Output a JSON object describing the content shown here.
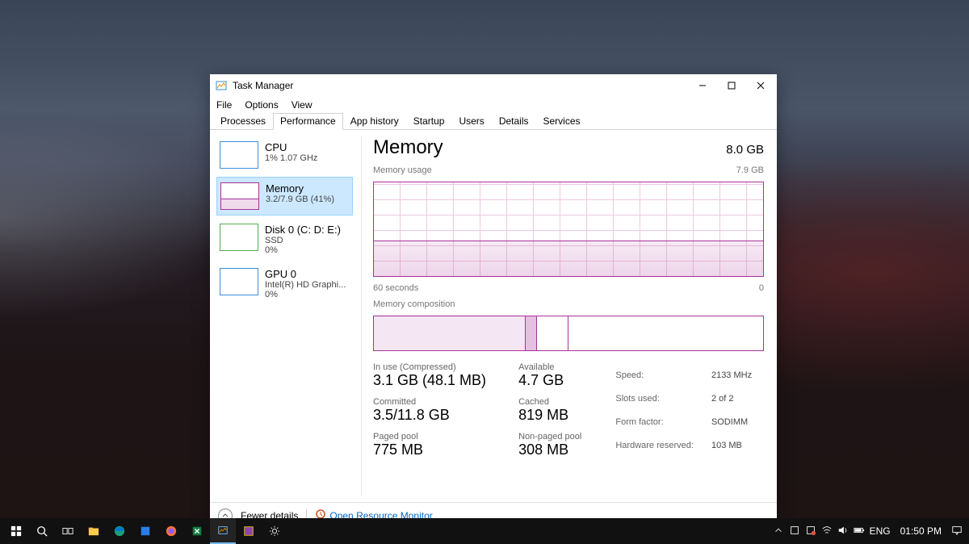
{
  "window": {
    "title": "Task Manager",
    "menus": {
      "file": "File",
      "options": "Options",
      "view": "View"
    },
    "tabs": {
      "processes": "Processes",
      "performance": "Performance",
      "apphistory": "App history",
      "startup": "Startup",
      "users": "Users",
      "details": "Details",
      "services": "Services"
    }
  },
  "sidebar": {
    "cpu": {
      "title": "CPU",
      "sub": "1% 1.07 GHz"
    },
    "memory": {
      "title": "Memory",
      "sub": "3.2/7.9 GB (41%)"
    },
    "disk": {
      "title": "Disk 0 (C: D: E:)",
      "sub1": "SSD",
      "sub2": "0%"
    },
    "gpu": {
      "title": "GPU 0",
      "sub1": "Intel(R) HD Graphi...",
      "sub2": "0%"
    }
  },
  "main": {
    "title": "Memory",
    "capacity": "8.0 GB",
    "usage_label": "Memory usage",
    "usage_max": "7.9 GB",
    "axis_left": "60 seconds",
    "axis_right": "0",
    "composition_label": "Memory composition",
    "stats": {
      "in_use_label": "In use (Compressed)",
      "in_use": "3.1 GB (48.1 MB)",
      "available_label": "Available",
      "available": "4.7 GB",
      "committed_label": "Committed",
      "committed": "3.5/11.8 GB",
      "cached_label": "Cached",
      "cached": "819 MB",
      "paged_label": "Paged pool",
      "paged": "775 MB",
      "nonpaged_label": "Non-paged pool",
      "nonpaged": "308 MB"
    },
    "info": {
      "speed_label": "Speed:",
      "speed": "2133 MHz",
      "slots_label": "Slots used:",
      "slots": "2 of 2",
      "form_label": "Form factor:",
      "form": "SODIMM",
      "reserved_label": "Hardware reserved:",
      "reserved": "103 MB"
    }
  },
  "footer": {
    "fewer": "Fewer details",
    "resmon": "Open Resource Monitor"
  },
  "taskbar": {
    "lang": "ENG",
    "time": "01:50 PM"
  },
  "colors": {
    "memory": "#a83298",
    "cpu": "#3b8edb",
    "disk": "#4caf50",
    "gpu": "#3b8edb"
  },
  "chart_data": {
    "type": "line",
    "title": "Memory usage",
    "xlabel": "seconds ago",
    "ylabel": "GB",
    "xlim": [
      60,
      0
    ],
    "ylim": [
      0,
      7.9
    ],
    "x": [
      60,
      55,
      50,
      45,
      40,
      35,
      30,
      25,
      20,
      15,
      10,
      5,
      0
    ],
    "values": [
      3.2,
      3.2,
      3.2,
      3.2,
      3.2,
      3.2,
      3.2,
      3.2,
      3.2,
      3.2,
      3.2,
      3.2,
      3.2
    ],
    "composition": {
      "in_use_gb": 3.1,
      "modified_gb": 0.2,
      "standby_gb": 0.6,
      "free_gb": 4.0,
      "total_gb": 7.9
    }
  }
}
